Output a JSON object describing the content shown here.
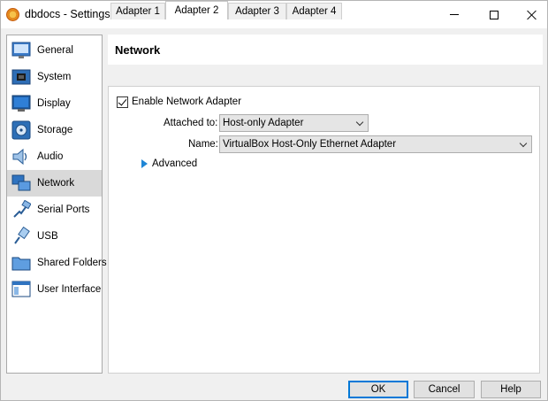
{
  "window": {
    "title": "dbdocs - Settings"
  },
  "sidebar": {
    "items": [
      {
        "label": "General",
        "icon": "general-icon"
      },
      {
        "label": "System",
        "icon": "system-icon"
      },
      {
        "label": "Display",
        "icon": "display-icon"
      },
      {
        "label": "Storage",
        "icon": "storage-icon"
      },
      {
        "label": "Audio",
        "icon": "audio-icon"
      },
      {
        "label": "Network",
        "icon": "network-icon",
        "selected": true
      },
      {
        "label": "Serial Ports",
        "icon": "serial-ports-icon"
      },
      {
        "label": "USB",
        "icon": "usb-icon"
      },
      {
        "label": "Shared Folders",
        "icon": "shared-folders-icon"
      },
      {
        "label": "User Interface",
        "icon": "user-interface-icon"
      }
    ]
  },
  "main": {
    "title": "Network",
    "tabs": [
      {
        "label": "Adapter 1"
      },
      {
        "label": "Adapter 2",
        "active": true
      },
      {
        "label": "Adapter 3"
      },
      {
        "label": "Adapter 4"
      }
    ],
    "enable_adapter": {
      "label": "Enable Network Adapter",
      "checked": true
    },
    "attached_to": {
      "label": "Attached to:",
      "value": "Host-only Adapter"
    },
    "name": {
      "label": "Name:",
      "value": "VirtualBox Host-Only Ethernet Adapter"
    },
    "advanced": {
      "label": "Advanced"
    }
  },
  "buttons": {
    "ok": "OK",
    "cancel": "Cancel",
    "help": "Help"
  },
  "colors": {
    "accent": "#0078d7",
    "selected_bg": "#d9d9d9",
    "expander": "#1f86d6"
  }
}
